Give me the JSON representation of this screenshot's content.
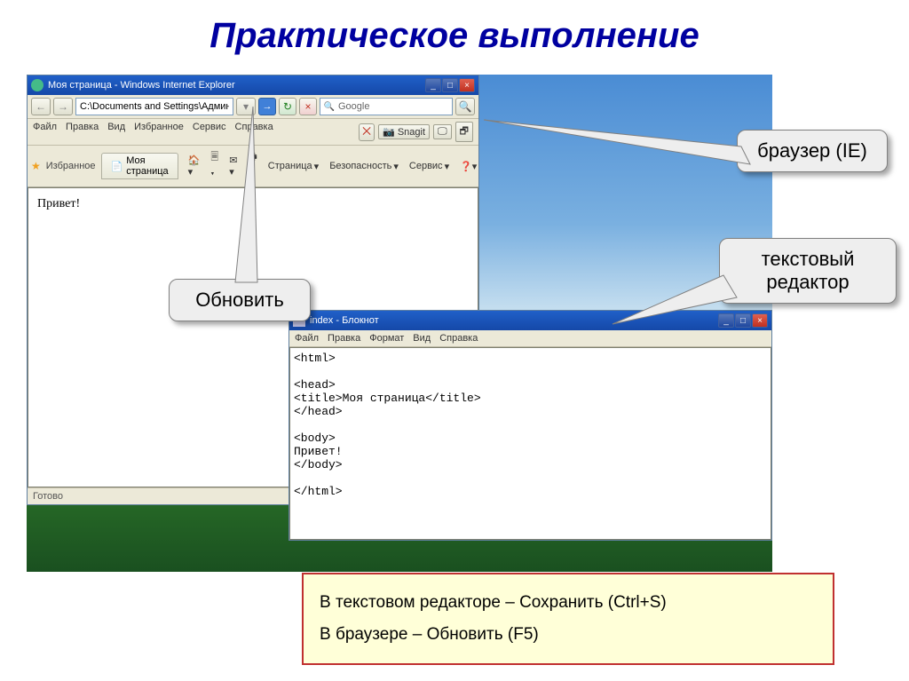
{
  "slide": {
    "title": "Практическое выполнение"
  },
  "ie": {
    "title": "Моя страница - Windows Internet Explorer",
    "url": "C:\\Documents and Settings\\Администратор\\Рабочий стол\\inde",
    "search_engine": "Google",
    "menu": {
      "file": "Файл",
      "edit": "Правка",
      "view": "Вид",
      "fav": "Избранное",
      "tools": "Сервис",
      "help": "Справка"
    },
    "snagit": "Snagit",
    "favorites": "Избранное",
    "tab_title": "Моя страница",
    "toolbar": {
      "page": "Страница",
      "security": "Безопасность",
      "service": "Сервис"
    },
    "content": "Привет!",
    "status": "Готово"
  },
  "notepad": {
    "title": "index - Блокнот",
    "menu": {
      "file": "Файл",
      "edit": "Правка",
      "format": "Формат",
      "view": "Вид",
      "help": "Справка"
    },
    "code": "<html>\n\n<head>\n<title>Моя страница</title>\n</head>\n\n<body>\nПривет!\n</body>\n\n</html>"
  },
  "callouts": {
    "browser": "браузер (IE)",
    "editor_l1": "текстовый",
    "editor_l2": "редактор",
    "refresh": "Обновить"
  },
  "tips": {
    "line1": "В текстовом редакторе – Сохранить (Ctrl+S)",
    "line2": "В браузере – Обновить (F5)"
  }
}
